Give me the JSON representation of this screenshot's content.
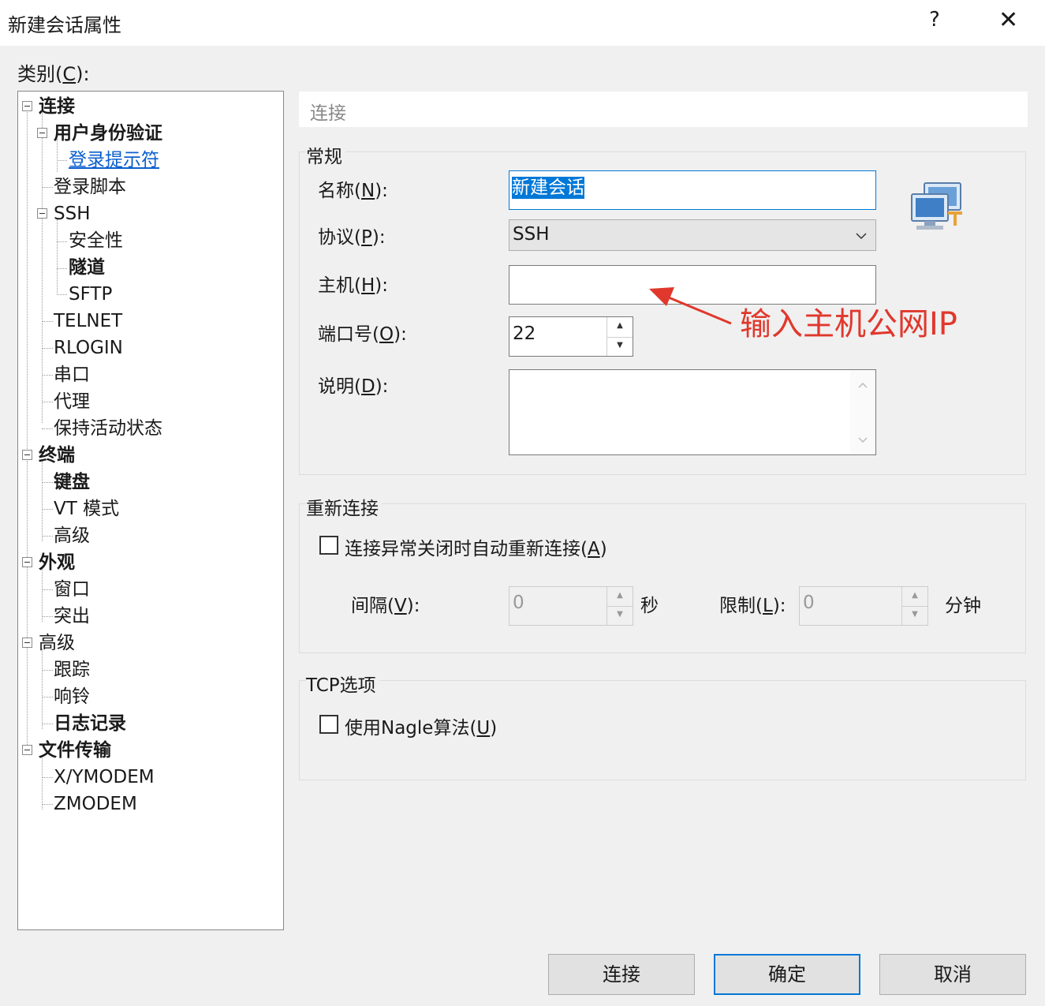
{
  "window": {
    "title": "新建会话属性",
    "help_icon": "?",
    "close_icon": "✕"
  },
  "category": {
    "label_prefix": "类别(",
    "label_key": "C",
    "label_suffix": "):"
  },
  "tree": [
    {
      "label": "连接",
      "bold": true
    },
    {
      "label": "用户身份验证",
      "bold": true
    },
    {
      "label": "登录提示符",
      "selected": true
    },
    {
      "label": "登录脚本"
    },
    {
      "label": "SSH"
    },
    {
      "label": "安全性"
    },
    {
      "label": "隧道",
      "bold": true
    },
    {
      "label": "SFTP"
    },
    {
      "label": "TELNET"
    },
    {
      "label": "RLOGIN"
    },
    {
      "label": "串口"
    },
    {
      "label": "代理"
    },
    {
      "label": "保持活动状态"
    },
    {
      "label": "终端",
      "bold": true
    },
    {
      "label": "键盘",
      "bold": true
    },
    {
      "label": "VT 模式"
    },
    {
      "label": "高级"
    },
    {
      "label": "外观",
      "bold": true
    },
    {
      "label": "窗口"
    },
    {
      "label": "突出"
    },
    {
      "label": "高级"
    },
    {
      "label": "跟踪"
    },
    {
      "label": "响铃"
    },
    {
      "label": "日志记录",
      "bold": true
    },
    {
      "label": "文件传输",
      "bold": true
    },
    {
      "label": "X/YMODEM"
    },
    {
      "label": "ZMODEM"
    }
  ],
  "panel": {
    "header": "连接"
  },
  "general": {
    "title": "常规",
    "name_label": "名称(",
    "name_key": "N",
    "label_end": "):",
    "name_value": "新建会话",
    "protocol_label": "协议(",
    "protocol_key": "P",
    "protocol_value": "SSH",
    "host_label": "主机(",
    "host_key": "H",
    "host_value": "",
    "port_label": "端口号(",
    "port_key": "O",
    "port_value": "22",
    "desc_label": "说明(",
    "desc_key": "D",
    "desc_value": ""
  },
  "annotation": "输入主机公网IP",
  "reconnect": {
    "title": "重新连接",
    "checkbox_label": "连接异常关闭时自动重新连接(",
    "checkbox_key": "A",
    "checkbox_end": ")",
    "checked": false,
    "interval_label": "间隔(",
    "interval_key": "V",
    "label_end": "):",
    "interval_value": "0",
    "interval_unit": "秒",
    "limit_label": "限制(",
    "limit_key": "L",
    "limit_value": "0",
    "limit_unit": "分钟"
  },
  "tcp": {
    "title": "TCP选项",
    "nagle_label": "使用Nagle算法(",
    "nagle_key": "U",
    "nagle_end": ")",
    "checked": false
  },
  "buttons": {
    "connect": "连接",
    "ok": "确定",
    "cancel": "取消"
  }
}
